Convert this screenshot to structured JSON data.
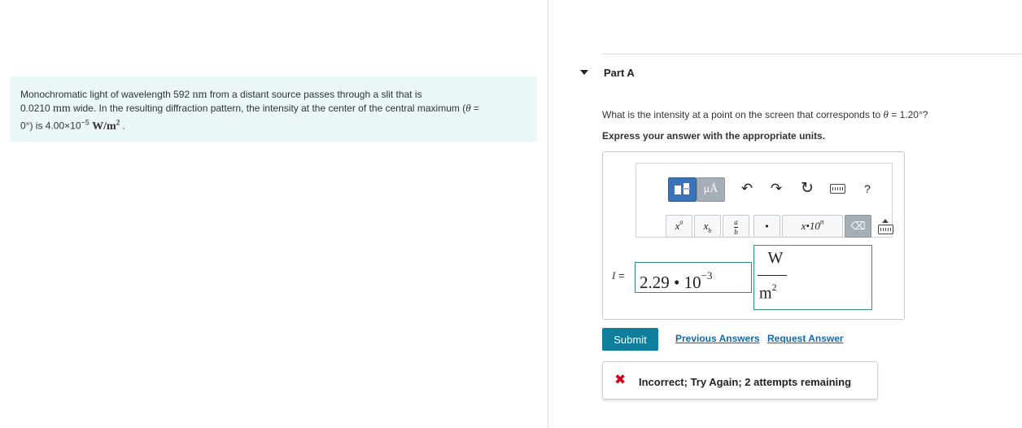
{
  "problem": {
    "line1_pre": "Monochromatic light of wavelength 592",
    "unit_nm": "nm",
    "line1_post": "from a distant source passes through a slit that is",
    "line2_value": "0.0210",
    "unit_mm": "mm",
    "line2_post": "wide. In the resulting diffraction pattern, the intensity at the center of the central maximum (",
    "theta": "θ",
    "equals": " =",
    "line3_pre": "0°) is 4.00×10",
    "exponent": "−5",
    "unit_W": "W/m",
    "unit_sq": "2",
    "line3_end": " ."
  },
  "part": {
    "title": "Part A",
    "question_pre": "What is the intensity at a point on the screen that corresponds to",
    "question_theta": "θ",
    "question_post": "= 1.20°?",
    "instruction": "Express your answer with the appropriate units."
  },
  "toolbar": {
    "units_label": "μÅ",
    "undo": "↶",
    "redo": "↷",
    "reset": "↻",
    "help": "?",
    "superscript_label": "x",
    "superscript_exp": "a",
    "subscript_label": "x",
    "subscript_sub": "b",
    "fraction_num": "a",
    "fraction_den": "b",
    "dot": "•",
    "sci_notation": "x•10",
    "sci_exp": "n",
    "delete": "⌫"
  },
  "answer": {
    "variable": "I",
    "equals": " =",
    "value": "2.29 • 10",
    "exponent": "−3",
    "unit_numerator": "W",
    "unit_denominator": "m",
    "unit_power": "2"
  },
  "actions": {
    "submit": "Submit",
    "previous_answers": "Previous Answers",
    "request_answer": "Request Answer"
  },
  "feedback": {
    "icon": "✖",
    "text": "Incorrect; Try Again; 2 attempts remaining"
  },
  "colors": {
    "problem_bg": "#eaf6f7",
    "submit_bg": "#0f7d9c",
    "link": "#1569ad",
    "error": "#d0021b",
    "input_border": "#2f8f83"
  }
}
